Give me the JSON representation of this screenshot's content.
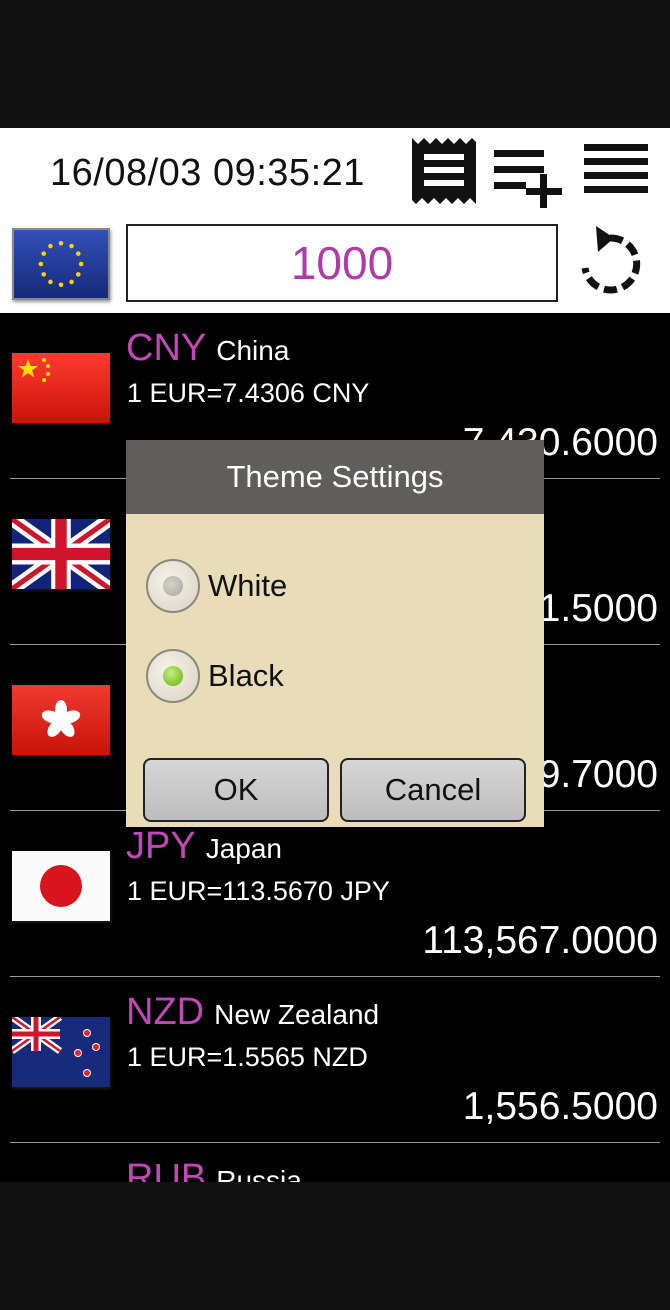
{
  "header": {
    "datetime": "16/08/03 09:35:21",
    "receipt_icon": "receipt-icon",
    "add_list_icon": "playlist-add-icon",
    "menu_icon": "menu-icon"
  },
  "base": {
    "currency_flag": "eu-flag",
    "amount": "1000",
    "refresh_icon": "refresh-icon"
  },
  "currencies": [
    {
      "code": "CNY",
      "country": "China",
      "rate": "1 EUR=7.4306 CNY",
      "converted": "7,430.6000",
      "flag": "cn-flag"
    },
    {
      "code": "",
      "country": "",
      "rate": "",
      "converted": "1.5000",
      "flag": "gb-flag"
    },
    {
      "code": "",
      "country": "",
      "rate": "",
      "converted": "9.7000",
      "flag": "hk-flag"
    },
    {
      "code": "JPY",
      "country": "Japan",
      "rate": "1 EUR=113.5670 JPY",
      "converted": "113,567.0000",
      "flag": "jp-flag"
    },
    {
      "code": "NZD",
      "country": "New Zealand",
      "rate": "1 EUR=1.5565 NZD",
      "converted": "1,556.5000",
      "flag": "nz-flag"
    },
    {
      "code": "RUB",
      "country": "Russia",
      "rate": "",
      "converted": "",
      "flag": ""
    }
  ],
  "dialog": {
    "title": "Theme Settings",
    "options": [
      {
        "label": "White",
        "selected": false
      },
      {
        "label": "Black",
        "selected": true
      }
    ],
    "ok_label": "OK",
    "cancel_label": "Cancel"
  },
  "colors": {
    "accent": "#c248b8",
    "dialog_bg": "#e8dcb9",
    "dialog_title_bg": "#5f5e5c"
  }
}
